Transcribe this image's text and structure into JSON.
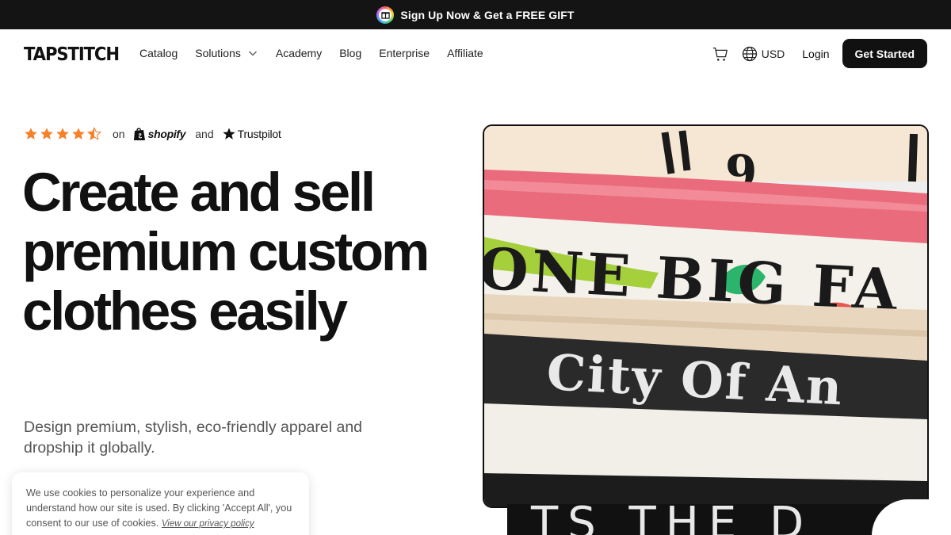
{
  "promo": {
    "text": "Sign Up Now & Get a FREE GIFT"
  },
  "brand": {
    "logo": "TAPSTITCH"
  },
  "nav": {
    "items": [
      {
        "label": "Catalog"
      },
      {
        "label": "Solutions"
      },
      {
        "label": "Academy"
      },
      {
        "label": "Blog"
      },
      {
        "label": "Enterprise"
      },
      {
        "label": "Affiliate"
      }
    ]
  },
  "header": {
    "currency": "USD",
    "login": "Login",
    "cta": "Get Started",
    "icons": [
      "cart-icon",
      "globe-icon",
      "chevron-down-icon"
    ]
  },
  "rating": {
    "stars": 4.5,
    "on": "on",
    "shopify": "shopify",
    "and": "and",
    "trustpilot": "Trustpilot"
  },
  "hero": {
    "headline": "Create and sell premium custom clothes easily",
    "subtext": "Design premium, stylish, eco-friendly apparel and dropship it globally.",
    "image_texts": [
      "9",
      "ONE BIG FA",
      "City Of An",
      "TS THE D"
    ]
  },
  "cookie": {
    "text": "We use cookies to personalize your experience and understand how our site is used. By clicking 'Accept All', you consent to our use of cookies.",
    "link": "View our privacy policy"
  },
  "colors": {
    "promo_bg": "#141414",
    "star": "#f5822a",
    "cta_bg": "#111111"
  }
}
